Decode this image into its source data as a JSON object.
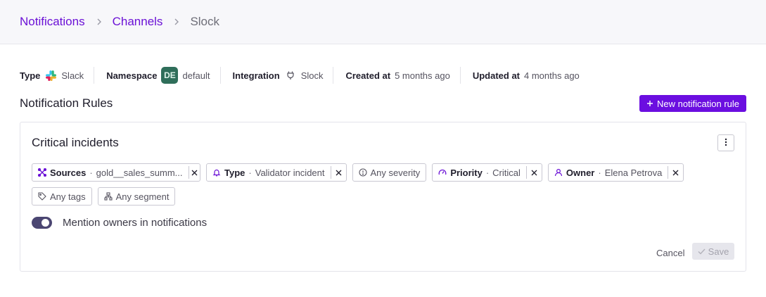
{
  "breadcrumb": {
    "items": [
      {
        "label": "Notifications"
      },
      {
        "label": "Channels"
      },
      {
        "label": "Slock"
      }
    ]
  },
  "meta": {
    "type": {
      "label": "Type",
      "value": "Slack",
      "icon": "slack-logo-icon"
    },
    "namespace": {
      "label": "Namespace",
      "avatar": "DE",
      "value": "default"
    },
    "integration": {
      "label": "Integration",
      "value": "Slock",
      "icon": "plug-icon"
    },
    "created": {
      "label": "Created at",
      "value": "5 months ago"
    },
    "updated": {
      "label": "Updated at",
      "value": "4 months ago"
    }
  },
  "section": {
    "title": "Notification Rules",
    "new_button_label": "New notification rule"
  },
  "rule": {
    "title": "Critical incidents",
    "filters": [
      {
        "key": "Sources",
        "value": "gold__sales_summ...",
        "icon": "sources-icon",
        "removable": true,
        "color": "#6b11d6"
      },
      {
        "key": "Type",
        "value": "Validator incident",
        "icon": "bell-icon",
        "removable": true,
        "color": "#6b11d6"
      },
      {
        "key": "",
        "value": "Any severity",
        "icon": "info-circle-icon",
        "removable": false,
        "color": "#55535f"
      },
      {
        "key": "Priority",
        "value": "Critical",
        "icon": "gauge-icon",
        "removable": true,
        "color": "#6b11d6"
      },
      {
        "key": "Owner",
        "value": "Elena Petrova",
        "icon": "user-icon",
        "removable": true,
        "color": "#6b11d6"
      },
      {
        "key": "",
        "value": "Any tags",
        "icon": "tag-icon",
        "removable": false,
        "color": "#55535f"
      },
      {
        "key": "",
        "value": "Any segment",
        "icon": "segment-icon",
        "removable": false,
        "color": "#55535f"
      }
    ],
    "mention_owners": {
      "label": "Mention owners in notifications",
      "enabled": true
    },
    "cancel_label": "Cancel",
    "save_label": "Save"
  },
  "colors": {
    "accent": "#6b0ee0",
    "toggle_on": "#4b4672",
    "breadcrumb_link": "#6b11d6"
  }
}
